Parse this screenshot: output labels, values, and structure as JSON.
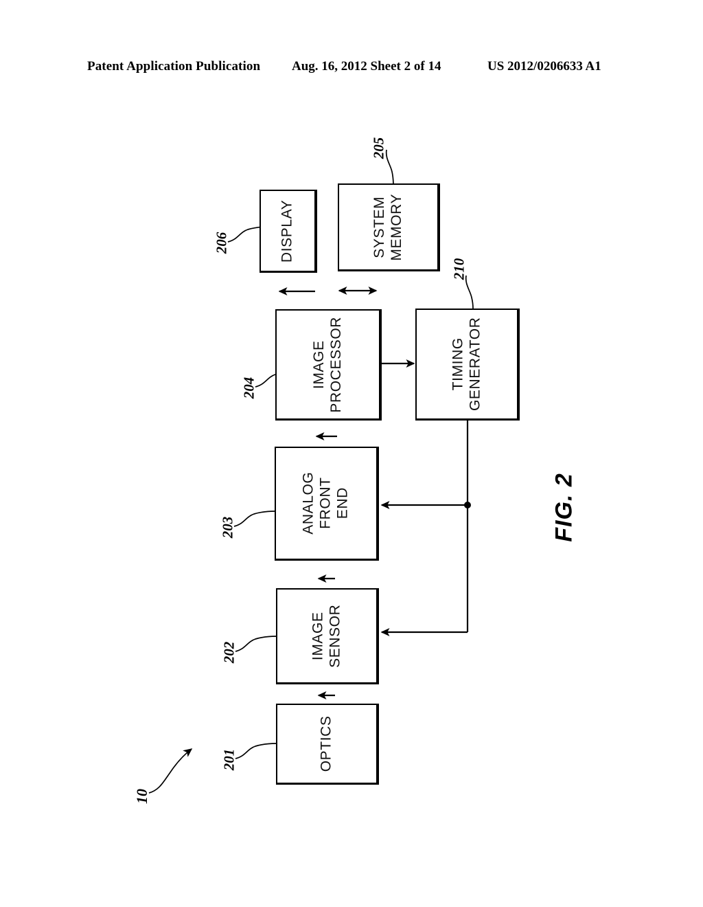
{
  "header": {
    "left": "Patent Application Publication",
    "middle": "Aug. 16, 2012  Sheet 2 of 14",
    "right": "US 2012/0206633 A1"
  },
  "figure": {
    "label": "FIG. 2",
    "system_ref": "10",
    "orientation": "rotated-90-ccw",
    "blocks": [
      {
        "id": "optics",
        "label": "OPTICS",
        "ref": "201"
      },
      {
        "id": "image-sensor",
        "label": "IMAGE\nSENSOR",
        "ref": "202"
      },
      {
        "id": "analog-front-end",
        "label": "ANALOG\nFRONT\nEND",
        "ref": "203"
      },
      {
        "id": "image-processor",
        "label": "IMAGE\nPROCESSOR",
        "ref": "204"
      },
      {
        "id": "system-memory",
        "label": "SYSTEM\nMEMORY",
        "ref": "205"
      },
      {
        "id": "display",
        "label": "DISPLAY",
        "ref": "206"
      },
      {
        "id": "timing-generator",
        "label": "TIMING\nGENERATOR",
        "ref": "210"
      }
    ],
    "connections": [
      {
        "from": "optics",
        "to": "image-sensor",
        "type": "single"
      },
      {
        "from": "image-sensor",
        "to": "analog-front-end",
        "type": "single"
      },
      {
        "from": "analog-front-end",
        "to": "image-processor",
        "type": "single"
      },
      {
        "from": "image-processor",
        "to": "display",
        "type": "single"
      },
      {
        "from": "image-processor",
        "to": "system-memory",
        "type": "bidirectional"
      },
      {
        "from": "image-processor",
        "to": "timing-generator",
        "type": "single"
      },
      {
        "from": "timing-generator",
        "to": "analog-front-end",
        "type": "single"
      },
      {
        "from": "timing-generator",
        "to": "image-sensor",
        "type": "single"
      }
    ]
  },
  "colors": {
    "ink": "#000000",
    "paper": "#ffffff"
  }
}
